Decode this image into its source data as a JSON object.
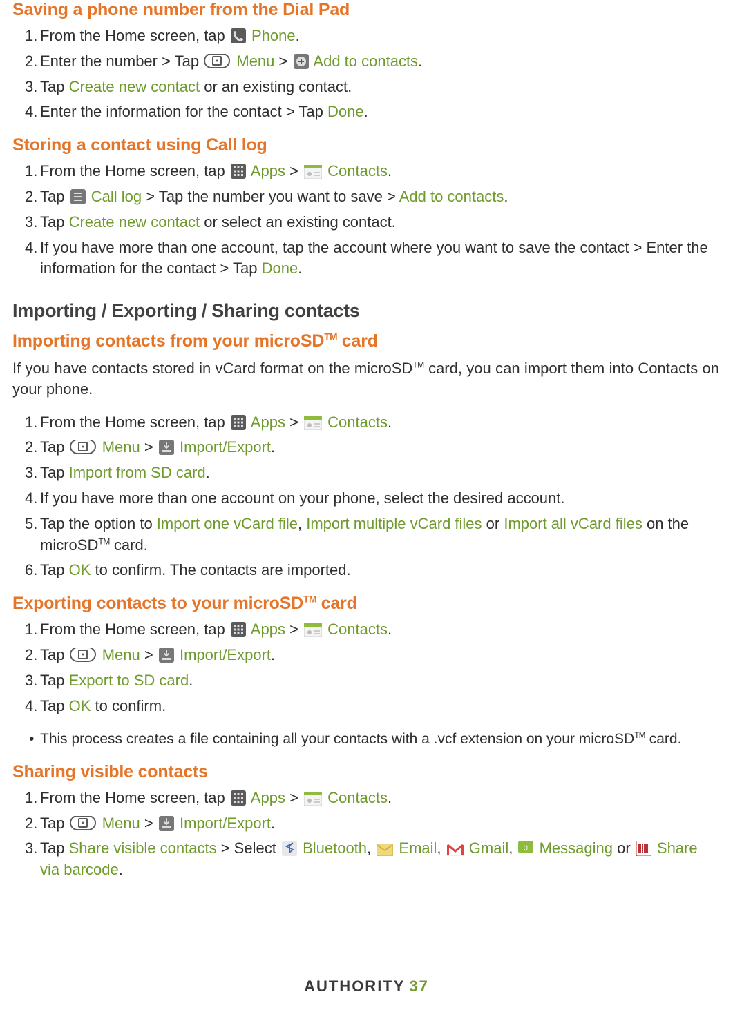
{
  "footer": {
    "brand": "AUTHORITY",
    "page": "37"
  },
  "secA": {
    "heading": "Saving a phone number from the Dial Pad",
    "s1a": "From the Home screen, tap ",
    "s1b": "Phone",
    "s1c": ".",
    "s2a": "Enter the number > Tap ",
    "s2b": "Menu",
    "s2c": " > ",
    "s2d": "Add to contacts",
    "s2e": ".",
    "s3a": "Tap ",
    "s3b": "Create new contact",
    "s3c": " or an existing contact.",
    "s4a": "Enter the information for the contact > Tap ",
    "s4b": "Done",
    "s4c": "."
  },
  "secB": {
    "heading": "Storing a contact using Call log",
    "s1a": "From the Home screen, tap ",
    "s1b": "Apps",
    "s1c": " > ",
    "s1d": "Contacts",
    "s1e": ".",
    "s2a": "Tap ",
    "s2b": "Call log",
    "s2c": " > Tap the number you want to save > ",
    "s2d": "Add to contacts",
    "s2e": ".",
    "s3a": "Tap ",
    "s3b": "Create new contact",
    "s3c": " or select an existing contact.",
    "s4a": "If you have more than one account, tap the account where you want to save the contact > Enter the information for the contact > Tap ",
    "s4b": "Done",
    "s4c": "."
  },
  "sectionTitle": "Importing / Exporting / Sharing contacts",
  "secC": {
    "heading_a": "Importing contacts from your microSD",
    "heading_b": " card",
    "intro_a": "If you have contacts stored in vCard format on the microSD",
    "intro_b": " card, you can import them into Contacts on your phone.",
    "s1a": "From the Home screen, tap ",
    "s1b": "Apps",
    "s1c": " > ",
    "s1d": "Contacts",
    "s1e": ".",
    "s2a": "Tap ",
    "s2b": "Menu",
    "s2c": " > ",
    "s2d": "Import/Export",
    "s2e": ".",
    "s3a": "Tap ",
    "s3b": "Import from SD card",
    "s3c": ".",
    "s4": "If you have more than one account on your phone, select the desired account.",
    "s5a": "Tap the option to ",
    "s5b": "Import one vCard file",
    "s5c": ", ",
    "s5d": "Import multiple vCard files",
    "s5e": " or ",
    "s5f": "Import all vCard files",
    "s5g": " on the microSD",
    "s5h": " card.",
    "s6a": "Tap ",
    "s6b": "OK",
    "s6c": " to confirm. The contacts are imported."
  },
  "secD": {
    "heading_a": "Exporting contacts to your microSD",
    "heading_b": " card",
    "s1a": "From the Home screen, tap ",
    "s1b": "Apps",
    "s1c": " > ",
    "s1d": "Contacts",
    "s1e": ".",
    "s2a": "Tap ",
    "s2b": "Menu",
    "s2c": " > ",
    "s2d": "Import/Export",
    "s2e": ".",
    "s3a": "Tap ",
    "s3b": "Export to SD card",
    "s3c": ".",
    "s4a": "Tap ",
    "s4b": "OK",
    "s4c": " to confirm.",
    "bullet_a": "This process creates a file containing all your contacts with a .vcf extension on your microSD",
    "bullet_b": " card."
  },
  "secE": {
    "heading": "Sharing visible contacts",
    "s1a": "From the Home screen, tap ",
    "s1b": "Apps",
    "s1c": " > ",
    "s1d": "Contacts",
    "s1e": ".",
    "s2a": "Tap ",
    "s2b": "Menu",
    "s2c": " > ",
    "s2d": "Import/Export",
    "s2e": ".",
    "s3a": "Tap ",
    "s3b": "Share visible contacts",
    "s3c": " > Select ",
    "s3d": "Bluetooth",
    "s3e": ", ",
    "s3f": "Email",
    "s3g": ", ",
    "s3h": "Gmail",
    "s3i": ", ",
    "s3j": "Messaging",
    "s3k": " or ",
    "s3l": "Share via barcode",
    "s3m": "."
  },
  "tm": "TM"
}
